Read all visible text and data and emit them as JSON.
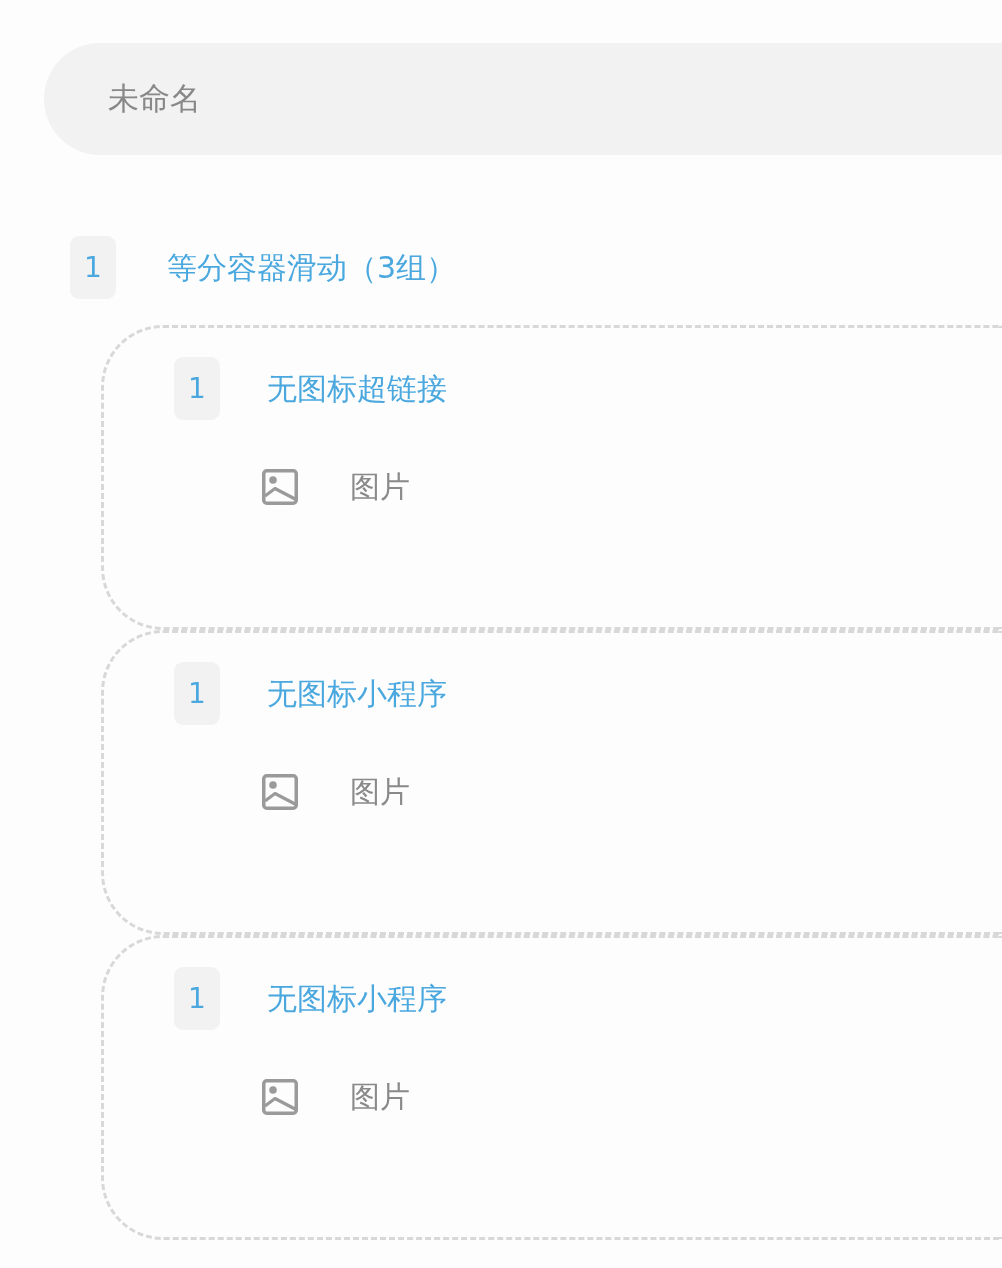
{
  "name_field": {
    "value": "未命名"
  },
  "component": {
    "index": "1",
    "title": "等分容器滑动（3组）",
    "groups": [
      {
        "index": "1",
        "title": "无图标超链接",
        "items": [
          {
            "kind": "image",
            "label": "图片"
          }
        ]
      },
      {
        "index": "1",
        "title": "无图标小程序",
        "items": [
          {
            "kind": "image",
            "label": "图片"
          }
        ]
      },
      {
        "index": "1",
        "title": "无图标小程序",
        "items": [
          {
            "kind": "image",
            "label": "图片"
          }
        ]
      }
    ]
  }
}
